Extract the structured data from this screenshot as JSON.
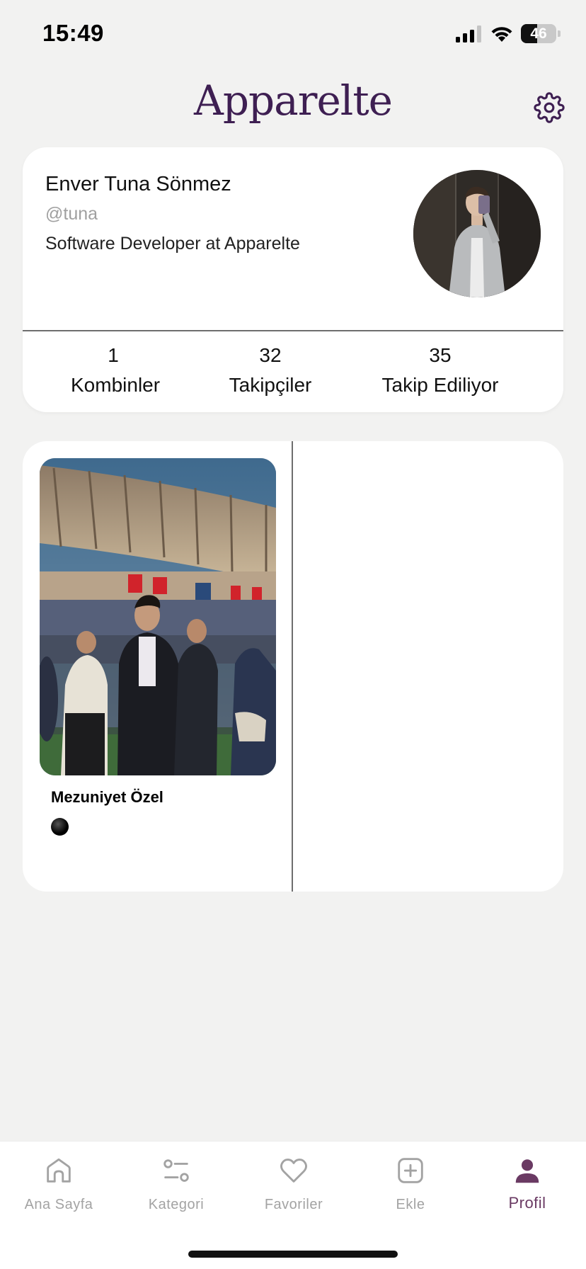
{
  "status_bar": {
    "time": "15:49",
    "battery_level": "46",
    "battery_fraction": 0.46
  },
  "header": {
    "logo": "Apparelte",
    "settings_icon": "gear-icon"
  },
  "profile": {
    "name": "Enver Tuna Sönmez",
    "handle": "@tuna",
    "bio": "Software Developer at Apparelte",
    "stats": [
      {
        "value": "1",
        "label": "Kombinler"
      },
      {
        "value": "32",
        "label": "Takipçiler"
      },
      {
        "value": "35",
        "label": "Takip Ediliyor"
      }
    ]
  },
  "outfits": [
    {
      "title": "Mezuniyet Özel",
      "colors": [
        "#000000"
      ]
    }
  ],
  "bottom_nav": {
    "items": [
      {
        "label": "Ana Sayfa",
        "icon": "home-icon",
        "active": false
      },
      {
        "label": "Kategori",
        "icon": "category-icon",
        "active": false
      },
      {
        "label": "Favoriler",
        "icon": "heart-icon",
        "active": false
      },
      {
        "label": "Ekle",
        "icon": "add-icon",
        "active": false
      },
      {
        "label": "Profil",
        "icon": "user-icon",
        "active": true
      }
    ],
    "active_color": "#6a3a63",
    "inactive_color": "#a3a3a3"
  },
  "colors": {
    "background": "#f2f2f1",
    "card": "#ffffff",
    "brand": "#3e1f52"
  }
}
